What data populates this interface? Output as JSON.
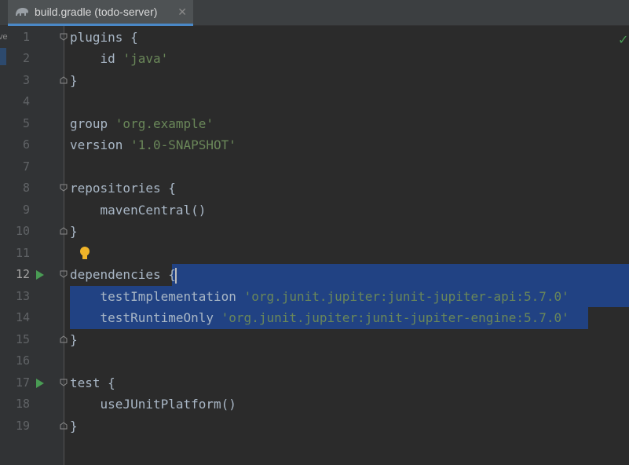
{
  "tab": {
    "title": "build.gradle (todo-server)",
    "close": "✕",
    "icon": "gradle-elephant-icon"
  },
  "side_hint": "ve",
  "status": {
    "check": "✓"
  },
  "colors": {
    "background": "#2b2b2b",
    "selection": "#214283",
    "string": "#6a8759",
    "text": "#a9b7c6",
    "run": "#499c54",
    "bulb": "#f0b429"
  },
  "lines": [
    {
      "n": "1",
      "code": "plugins {",
      "parts": [
        {
          "t": "plugins {",
          "c": "kw"
        }
      ]
    },
    {
      "n": "2",
      "parts": [
        {
          "t": "    id ",
          "c": "kw"
        },
        {
          "t": "'java'",
          "c": "str"
        }
      ]
    },
    {
      "n": "3",
      "parts": [
        {
          "t": "}",
          "c": "kw"
        }
      ]
    },
    {
      "n": "4",
      "parts": []
    },
    {
      "n": "5",
      "parts": [
        {
          "t": "group ",
          "c": "kw"
        },
        {
          "t": "'org.example'",
          "c": "str"
        }
      ]
    },
    {
      "n": "6",
      "parts": [
        {
          "t": "version ",
          "c": "kw"
        },
        {
          "t": "'1.0-SNAPSHOT'",
          "c": "str"
        }
      ]
    },
    {
      "n": "7",
      "parts": []
    },
    {
      "n": "8",
      "parts": [
        {
          "t": "repositories {",
          "c": "kw"
        }
      ]
    },
    {
      "n": "9",
      "parts": [
        {
          "t": "    mavenCentral()",
          "c": "kw"
        }
      ]
    },
    {
      "n": "10",
      "parts": [
        {
          "t": "}",
          "c": "kw"
        }
      ]
    },
    {
      "n": "11",
      "parts": []
    },
    {
      "n": "12",
      "parts": [
        {
          "t": "dependencies {",
          "c": "kw"
        }
      ]
    },
    {
      "n": "13",
      "parts": [
        {
          "t": "    testImplementation ",
          "c": "kw"
        },
        {
          "t": "'org.junit.jupiter:junit-jupiter-api:5.7.0'",
          "c": "str"
        }
      ]
    },
    {
      "n": "14",
      "parts": [
        {
          "t": "    testRuntimeOnly ",
          "c": "kw"
        },
        {
          "t": "'org.junit.jupiter:junit-jupiter-engine:5.7.0'",
          "c": "str"
        }
      ]
    },
    {
      "n": "15",
      "parts": [
        {
          "t": "}",
          "c": "kw"
        }
      ]
    },
    {
      "n": "16",
      "parts": []
    },
    {
      "n": "17",
      "parts": [
        {
          "t": "test {",
          "c": "kw"
        }
      ]
    },
    {
      "n": "18",
      "parts": [
        {
          "t": "    useJUnitPlatform()",
          "c": "kw"
        }
      ]
    },
    {
      "n": "19",
      "parts": [
        {
          "t": "}",
          "c": "kw"
        }
      ]
    }
  ],
  "current_line": "12",
  "run_lines": [
    "12",
    "17"
  ],
  "fold_lines": [
    "1",
    "3",
    "8",
    "10",
    "12",
    "15",
    "17",
    "19"
  ],
  "selected_lines": [
    "12",
    "13",
    "14"
  ],
  "bulb_line": "11"
}
